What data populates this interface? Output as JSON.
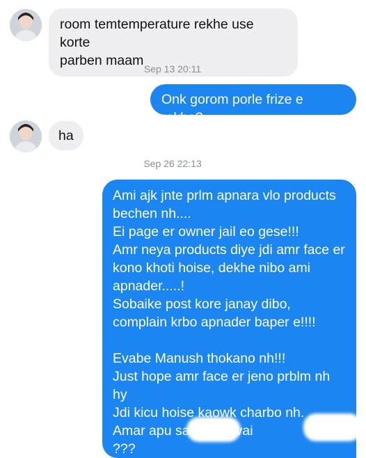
{
  "conversation": {
    "messages": [
      {
        "sender": "contact",
        "text": "room temtemperature rekhe use korte\nparben maam"
      },
      {
        "timestamp": "Sep 13 20:11"
      },
      {
        "sender": "me",
        "text": "Onk gorom porle frize e rakbo?"
      },
      {
        "sender": "contact",
        "text": "ha"
      },
      {
        "timestamp": "Sep 26 22:13"
      },
      {
        "sender": "me",
        "text": "Ami ajk jnte prlm apnara vlo products\nbechen nh....\nEi page er owner jail eo gese!!!\nAmr neya products diye jdi amr face er\nkono khoti hoise, dekhe nibo ami\napnader.....!\nSobaike post kore janay dibo,\ncomplain krbo apnader baper e!!!!\n\nEvabe Manush thokano nh!!!\nJust hope amr face er jeno prblm nh\nhy\nJdi kicu hoise kaowk charbo nh.\nAmar apu sa           o, amr vai\n???"
      }
    ]
  },
  "colors": {
    "incoming_bubble": "#eeeef0",
    "outgoing_bubble": "#1b85f2",
    "timestamp_text": "#8a8d91"
  },
  "icons": {
    "contact_avatar": "avatar-photo-icon"
  }
}
